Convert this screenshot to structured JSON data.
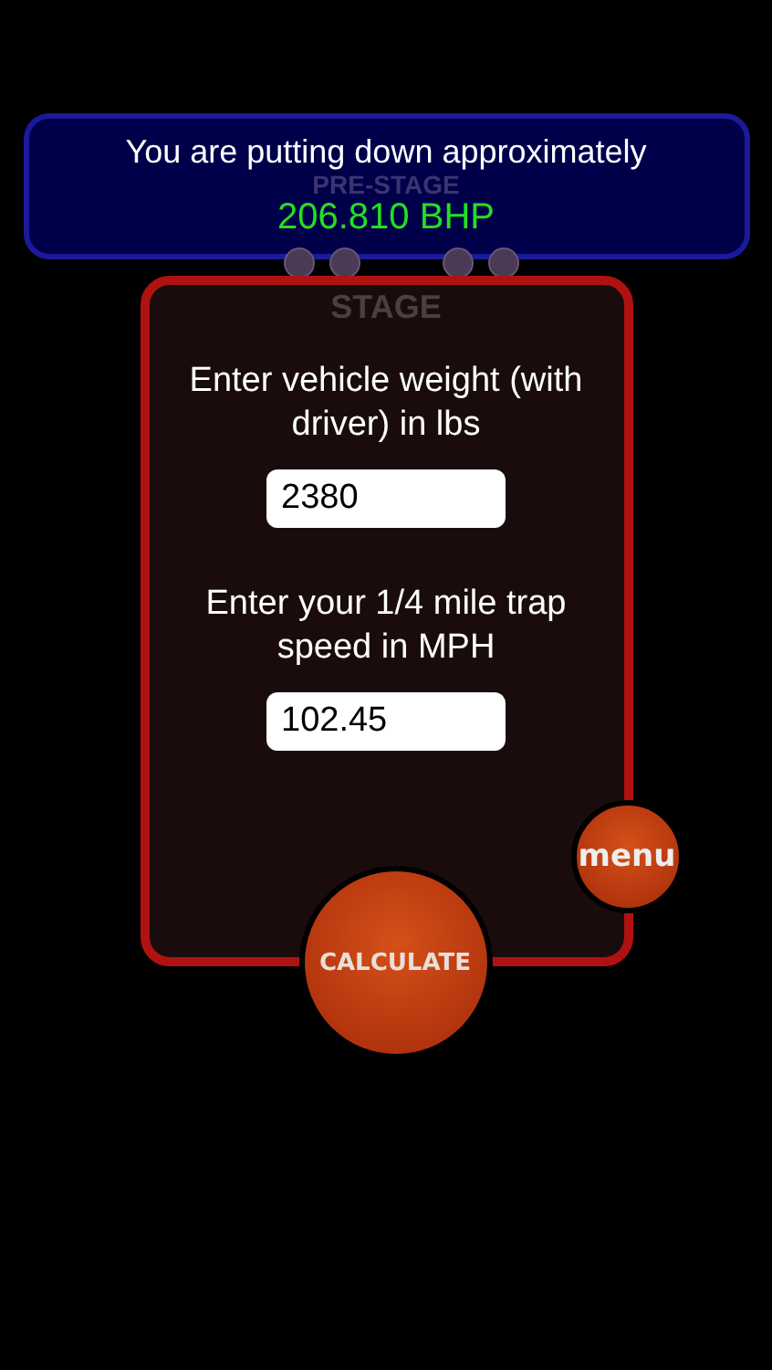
{
  "result": {
    "label": "You are putting down approximately",
    "value": "206.810 BHP"
  },
  "tree": {
    "prestage": "PRE-STAGE",
    "stage": "STAGE"
  },
  "inputs": [
    {
      "label": "Enter vehicle weight (with driver) in lbs",
      "value": "2380"
    },
    {
      "label": "Enter your 1/4 mile trap speed in MPH",
      "value": "102.45"
    }
  ],
  "menu_button": "menu",
  "calculate_button": "CALCULATE"
}
